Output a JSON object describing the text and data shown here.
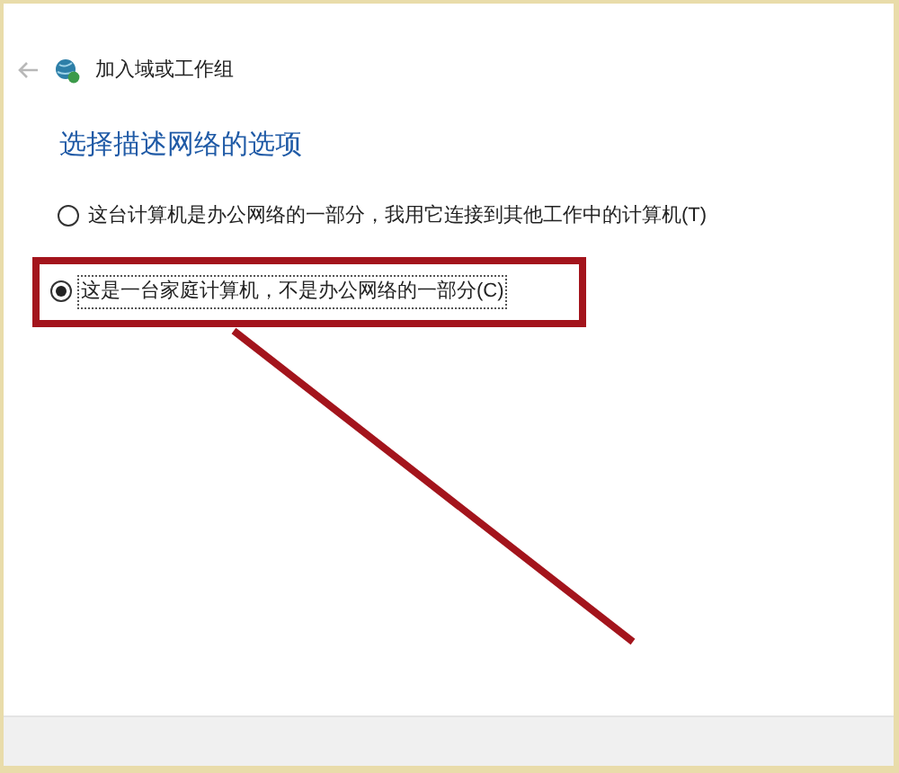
{
  "window": {
    "title": "加入域或工作组"
  },
  "heading": "选择描述网络的选项",
  "options": [
    {
      "label": "这台计算机是办公网络的一部分，我用它连接到其他工作中的计算机(T)",
      "selected": false,
      "highlighted": false
    },
    {
      "label": "这是一台家庭计算机，不是办公网络的一部分(C)",
      "selected": true,
      "highlighted": true
    }
  ]
}
